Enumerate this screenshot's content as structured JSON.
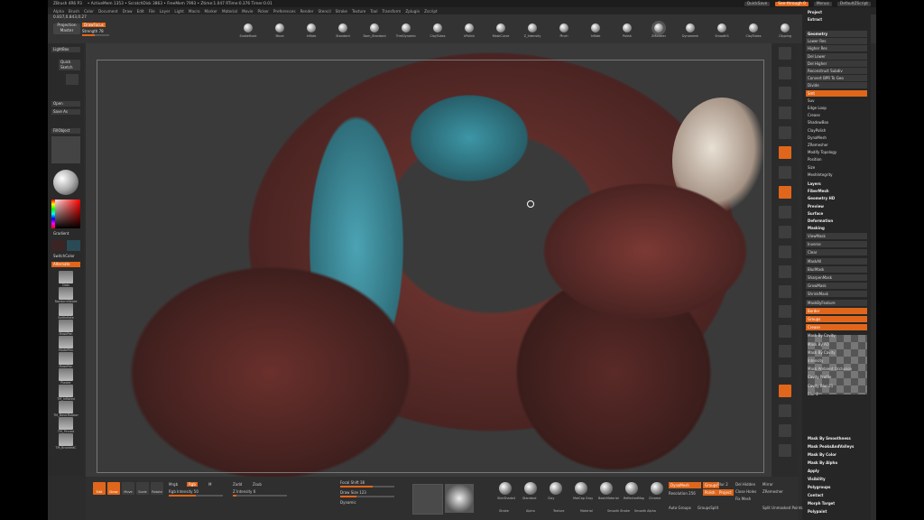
{
  "colors": {
    "accent": "#e0661b",
    "bg": "#2c2c2c",
    "panel": "#262626"
  },
  "titlebar": {
    "app": "ZBrush 4R6 P3",
    "title": "• ActiveMem 1353 • ScratchDisk 3863 • FreeMem 7993 • Ztime:1.047 RTime:0.376 Timer:0.01",
    "quicksave": "QuickSave",
    "seethrough": "See-through 0",
    "menus": "Menus",
    "script": "DefaultZScript"
  },
  "menubar": [
    "Alpha",
    "Brush",
    "Color",
    "Document",
    "Draw",
    "Edit",
    "File",
    "Layer",
    "Light",
    "Macro",
    "Marker",
    "Material",
    "Movie",
    "Picker",
    "Preferences",
    "Render",
    "Stencil",
    "Stroke",
    "Texture",
    "Tool",
    "Transform",
    "Zplugin",
    "Zscript"
  ],
  "top": {
    "coords": "0.837,0.843,0.27",
    "projection": "Projection Master",
    "lightbox": "LightBox",
    "quicksketch": "Quick Sketch",
    "draw_label": "DrawFocus",
    "strength": "Strength 78"
  },
  "brushes": [
    {
      "name": "SnakeHook",
      "selected": false
    },
    {
      "name": "Move",
      "selected": false
    },
    {
      "name": "Inflate",
      "selected": false
    },
    {
      "name": "Standard",
      "selected": false
    },
    {
      "name": "Dam_Standard",
      "selected": false
    },
    {
      "name": "TrimDynamic",
      "selected": false
    },
    {
      "name": "ClayTubes",
      "selected": false
    },
    {
      "name": "hPolish",
      "selected": false
    },
    {
      "name": "MaskCurve",
      "selected": false
    },
    {
      "name": "Z_Intensity",
      "selected": false
    },
    {
      "name": "Pinch",
      "selected": false
    },
    {
      "name": "Inflate",
      "selected": false
    },
    {
      "name": "Polish",
      "selected": false
    },
    {
      "name": "ZModeler",
      "selected": true
    },
    {
      "name": "Dynamesh",
      "selected": false
    },
    {
      "name": "SmoothS",
      "selected": false
    },
    {
      "name": "ClayTubes",
      "selected": false
    },
    {
      "name": "Clipping",
      "selected": false
    }
  ],
  "left": {
    "lightbox": "LightBox",
    "quick_sketch": "Quick Sketch",
    "open": "Open",
    "save_as": "Save As",
    "fill_object": "FillObject",
    "gradient": "Gradient",
    "switch_color": "SwitchColor",
    "alternate": "Alternate",
    "alphas": [
      "Dots",
      "RandomStroke",
      "SoftInflate",
      "MaskPen",
      "ModelPen",
      "MaskPen",
      "Plaster",
      "TM_Inflated",
      "TM_BasicRubber",
      "TM_Pinned",
      "TM_BrushedC"
    ]
  },
  "right_panel": {
    "top": [
      "Project",
      "Extract"
    ],
    "geom": [
      "Geometry",
      "Lower Res",
      "Higher Res",
      "Del Lower",
      "Del Higher",
      "Reconstruct Subdiv",
      "Convert BPR To Geo",
      "Divide",
      "Smt",
      "Suv",
      "Edge Loop",
      "Crease",
      "ShadowBox",
      "ClayPolish",
      "DynaMesh",
      "ZRemesher",
      "Modify Topology",
      "Position",
      "Size",
      "MeshIntegrity"
    ],
    "sections": [
      "Layers",
      "FiberMesh",
      "Geometry HD",
      "Preview",
      "Surface",
      "Deformation",
      "Masking"
    ],
    "masking": [
      "ViewMask",
      "Inverse",
      "Clear",
      "MaskAll",
      "BlurMask",
      "SharpenMask",
      "GrowMask",
      "ShrinkMask",
      "MaskByFeature",
      "Border",
      "Groups",
      "Crease",
      "Mask By Cavity",
      "Mask By AO",
      "Mask By Cavity",
      "Intensity",
      "Mask Ambient Occlusion",
      "Cavity Profile",
      "Cavity Blur 21",
      "Blur 2"
    ],
    "bottom": [
      "Mask By Smoothness",
      "Mask PeaksAndValleys",
      "Mask By Color",
      "Mask By Alpha",
      "Apply",
      "Visibility",
      "Polygroups",
      "Contact",
      "Morph Target",
      "Polypaint"
    ]
  },
  "bottom": {
    "edit": "Edit",
    "draw": "Draw",
    "move": "Move",
    "scale": "Scale",
    "rotate": "Rotate",
    "mrgb": "Mrgb",
    "rgb": "Rgb",
    "m": "M",
    "zadd": "Zadd",
    "zsub": "Zsub",
    "rgb_intensity": "Rgb Intensity 50",
    "z_intensity": "Z Intensity 6",
    "focal_shift": "Focal Shift 38",
    "draw_size": "Draw Size 123",
    "dynamic": "Dynamic",
    "materials": [
      "SkinShade4",
      "Standard",
      "Clay",
      "MatCap Gray",
      "BasicMaterial",
      "ReflectedMap",
      "Chrome"
    ],
    "mat_labels2": [
      "Stroke",
      "Alpha",
      "Texture",
      "Material",
      "Smooth Stroke",
      "Smooth Alpha"
    ],
    "dynamesh": "DynaMesh",
    "groups": "Groups",
    "polish": "Polish",
    "resolution": "Resolution 256",
    "blur": "Blur 2",
    "project": "Project",
    "del_hidden": "Del Hidden",
    "close_holes": "Close Holes",
    "fix_mesh": "Fix Mesh",
    "auto_groups": "Auto Groups",
    "groups_split": "GroupsSplit",
    "split_hidden": "Split Unmasked Points",
    "mirror": "Mirror",
    "zremesher": "ZRemesher"
  }
}
